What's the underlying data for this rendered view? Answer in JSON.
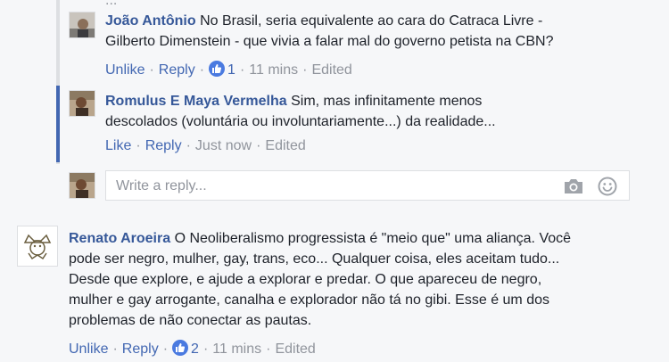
{
  "top_fragment": "...",
  "replies": [
    {
      "author": "João Antônio",
      "text_line1": "No Brasil, seria equivalente ao cara do Catraca Livre -",
      "text_line2": "Gilberto Dimenstein - que vivia a falar mal do governo petista na CBN?",
      "like_label": "Unlike",
      "reply_label": "Reply",
      "reactions": "1",
      "time": "11 mins",
      "edited": "Edited"
    },
    {
      "author": "Romulus E Maya Vermelha",
      "text_line1": "Sim, mas infinitamente menos",
      "text_line2": "descolados (voluntária ou involuntariamente...) da realidade...",
      "like_label": "Like",
      "reply_label": "Reply",
      "time": "Just now",
      "edited": "Edited"
    }
  ],
  "reply_box": {
    "placeholder": "Write a reply..."
  },
  "comment": {
    "author": "Renato Aroeira",
    "lines": [
      "O Neoliberalismo progressista é \"meio que\" uma aliança. Você",
      "pode ser negro, mulher, gay, trans, eco... Qualquer coisa, eles aceitam tudo...",
      "Desde que explore, e ajude a explorar e predar. O que apareceu de negro,",
      "mulher e gay arrogante, canalha e explorador não tá no gibi. Esse é um dos",
      "problemas de não conectar as pautas."
    ],
    "like_label": "Unlike",
    "reply_label": "Reply",
    "reactions": "2",
    "time": "11 mins",
    "edited": "Edited"
  },
  "colors": {
    "link": "#4267b2",
    "name": "#365899",
    "meta": "#90949c",
    "active_thread": "#4267b2",
    "like_badge": "#4a7ae0"
  },
  "icons": [
    "camera-icon",
    "smiley-icon",
    "thumbs-up-icon"
  ]
}
